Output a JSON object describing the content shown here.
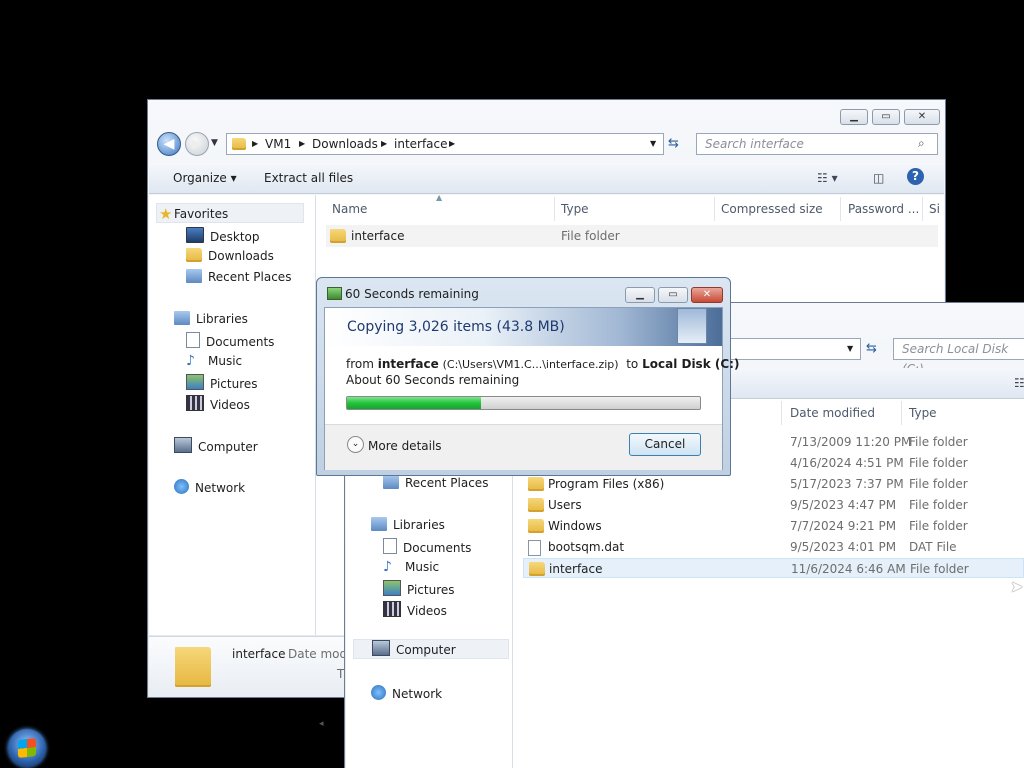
{
  "back_window": {
    "breadcrumb": [
      "VM1",
      "Downloads",
      "interface"
    ],
    "search_placeholder": "Search interface",
    "toolbar": {
      "organize": "Organize",
      "extract": "Extract all files"
    },
    "columns": [
      "Name",
      "Type",
      "Compressed size",
      "Password ...",
      "Si"
    ],
    "files": [
      {
        "name": "interface",
        "type": "File folder"
      }
    ],
    "nav": {
      "favorites": "Favorites",
      "favorites_items": [
        "Desktop",
        "Downloads",
        "Recent Places"
      ],
      "libraries": "Libraries",
      "libraries_items": [
        "Documents",
        "Music",
        "Pictures",
        "Videos"
      ],
      "computer": "Computer",
      "network": "Network"
    },
    "details": {
      "name": "interface",
      "label": "Date modi",
      "type_label": "T"
    }
  },
  "front_window": {
    "search_placeholder": "Search Local Disk (C:)",
    "columns": [
      "Date modified",
      "Type"
    ],
    "rows": [
      {
        "name": "",
        "date": "7/13/2009 11:20 PM",
        "type": "File folder",
        "icon": "folder"
      },
      {
        "name": "",
        "date": "4/16/2024 4:51 PM",
        "type": "File folder",
        "icon": "folder"
      },
      {
        "name": "Program Files (x86)",
        "date": "5/17/2023 7:37 PM",
        "type": "File folder",
        "icon": "folder"
      },
      {
        "name": "Users",
        "date": "9/5/2023 4:47 PM",
        "type": "File folder",
        "icon": "folder"
      },
      {
        "name": "Windows",
        "date": "7/7/2024 9:21 PM",
        "type": "File folder",
        "icon": "folder"
      },
      {
        "name": "bootsqm.dat",
        "date": "9/5/2023 4:01 PM",
        "type": "DAT File",
        "icon": "file"
      },
      {
        "name": "interface",
        "date": "11/6/2024 6:46 AM",
        "type": "File folder",
        "icon": "folder"
      }
    ],
    "nav": {
      "recent": "Recent Places",
      "libraries": "Libraries",
      "libraries_items": [
        "Documents",
        "Music",
        "Pictures",
        "Videos"
      ],
      "computer": "Computer",
      "network": "Network"
    }
  },
  "copy_dialog": {
    "title": "60 Seconds remaining",
    "heading": "Copying 3,026 items (43.8 MB)",
    "from_label": "from",
    "from_name": "interface",
    "from_path": "(C:\\Users\\VM1.C...\\interface.zip)",
    "to_label": "to",
    "to_name": "Local Disk (C:)",
    "remaining": "About 60 Seconds remaining",
    "progress": 0.38,
    "more_details": "More details",
    "cancel": "Cancel"
  },
  "colors": {
    "progress": "#22c43a",
    "heading": "#1e3a6e",
    "selection": "#e5f0fb"
  }
}
